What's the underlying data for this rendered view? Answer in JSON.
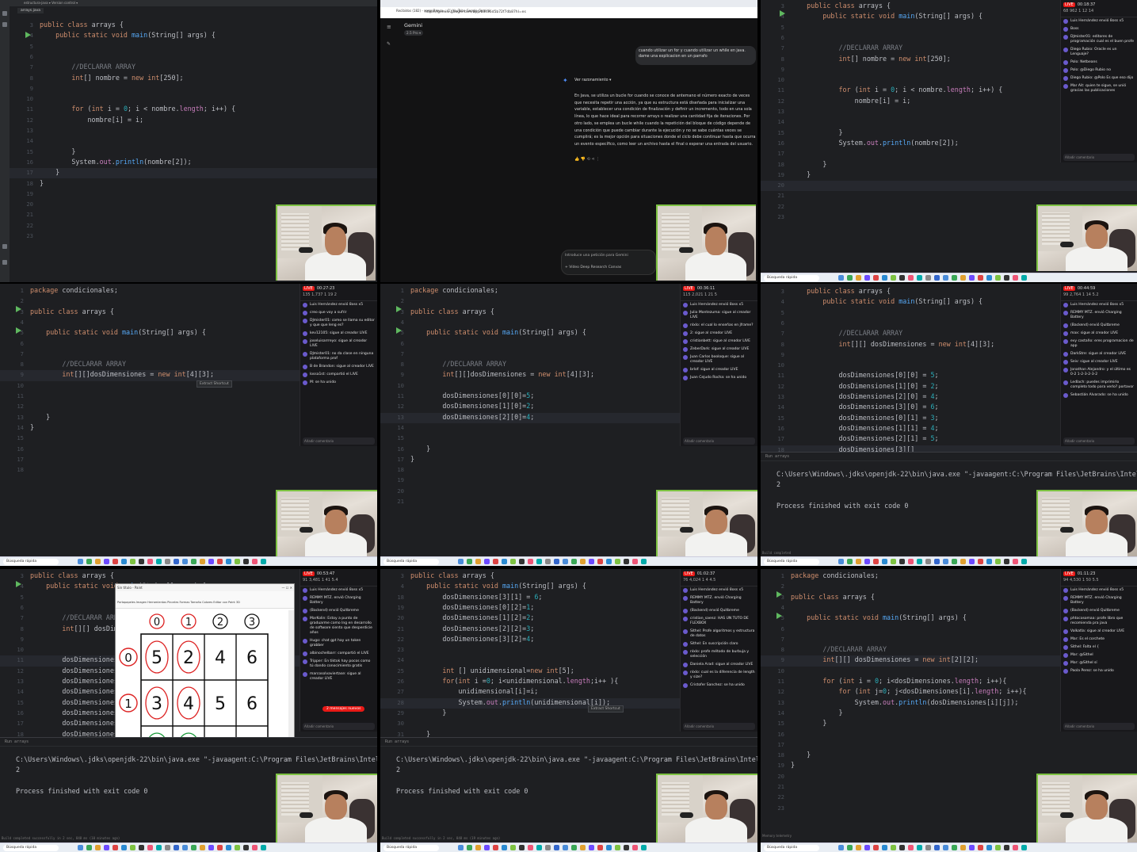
{
  "panel1": {
    "toolbar": "estructura-java ▾     Version control ▾",
    "file_tab": "arrays.java",
    "lines": [
      {
        "n": "3",
        "t": "public class arrays {"
      },
      {
        "n": "4",
        "t": "    public static void main(String[] args) {"
      },
      {
        "n": "5",
        "t": ""
      },
      {
        "n": "6",
        "t": ""
      },
      {
        "n": "7",
        "t": "        //DECLARAR ARRAY"
      },
      {
        "n": "8",
        "t": "        int[] nombre = new int[250];"
      },
      {
        "n": "9",
        "t": ""
      },
      {
        "n": "10",
        "t": ""
      },
      {
        "n": "11",
        "t": "        for (int i = 0; i < nombre.length; i++) {"
      },
      {
        "n": "12",
        "t": "            nombre[i] = i;"
      },
      {
        "n": "13",
        "t": ""
      },
      {
        "n": "14",
        "t": ""
      },
      {
        "n": "15",
        "t": "        }"
      },
      {
        "n": "16",
        "t": "        System.out.println(nombre[2]);"
      },
      {
        "n": "17",
        "t": "    }"
      },
      {
        "n": "18",
        "t": "}"
      },
      {
        "n": "19",
        "t": ""
      },
      {
        "n": "20",
        "t": ""
      },
      {
        "n": "21",
        "t": ""
      },
      {
        "n": "22",
        "t": ""
      },
      {
        "n": "23",
        "t": ""
      }
    ]
  },
  "panel2": {
    "tabs": "Recibidos (182) - sesanBanco...    (1) YouTube    Google Gemini",
    "url": "https://gemini.google.com/app/b3c36d5b72f7db87hl=es",
    "brand": "Gemini",
    "model": "2.5 Pro ▾",
    "question": "cuando utilizar un for y cuando utilizar un while en java. dame una explicacion en un parrafo",
    "reasoning": "Ver razonamiento",
    "answer": "En Java, se utiliza un bucle for cuando se conoce de antemano el número exacto de veces que necesita repetir una acción, ya que su estructura está diseñada para inicializar una variable, establecer una condición de finalización y definir un incremento, todo en una sola línea, lo que hace ideal para recorrer arrays o realizar una cantidad fija de iteraciones. Por otro lado, se emplea un bucle while cuando la repetición del bloque de código depende de una condición que puede cambiar durante la ejecución y no se sabe cuántas veces se cumplirá; es la mejor opción para situaciones donde el ciclo debe continuar hasta que ocurra un evento específico, como leer un archivo hasta el final o esperar una entrada del usuario.",
    "input_placeholder": "Introduce una petición para Gemini",
    "tools": "+    Vídeo    Deep Research    Canvas"
  },
  "panel3": {
    "lines": [
      {
        "n": "3",
        "t": "    public class arrays {"
      },
      {
        "n": "4",
        "t": "        public static void main(String[] args) {"
      },
      {
        "n": "5",
        "t": ""
      },
      {
        "n": "6",
        "t": ""
      },
      {
        "n": "7",
        "t": "            //DECLARAR ARRAY"
      },
      {
        "n": "8",
        "t": "            int[] nombre = new int[250];"
      },
      {
        "n": "9",
        "t": ""
      },
      {
        "n": "10",
        "t": ""
      },
      {
        "n": "11",
        "t": "            for (int i = 0; i < nombre.length; i++) {"
      },
      {
        "n": "12",
        "t": "                nombre[i] = i;"
      },
      {
        "n": "13",
        "t": ""
      },
      {
        "n": "14",
        "t": ""
      },
      {
        "n": "15",
        "t": "            }"
      },
      {
        "n": "16",
        "t": "            System.out.println(nombre[2]);"
      },
      {
        "n": "17",
        "t": ""
      },
      {
        "n": "18",
        "t": "        }"
      },
      {
        "n": "19",
        "t": "    }"
      },
      {
        "n": "20",
        "t": ""
      },
      {
        "n": "21",
        "t": ""
      },
      {
        "n": "22",
        "t": ""
      },
      {
        "n": "23",
        "t": ""
      }
    ],
    "live_time": "00:18:37",
    "stats": "68   962   1   12   14",
    "chat": [
      "Luis Hernández envió 8oss  x5",
      "Boss",
      "DJmister01: editores de programación cual es el buen profe",
      "Diego Rubio: Oracle es un Lenguaje?",
      "Polo: Netbeans",
      "Polo: @Diego Rubio no",
      "Diego Rubio: @Polo Es que eso dijo",
      "Mar Ait: quien te sigue, se unió gracias las publicaciones"
    ],
    "chat_input": "Añadir comentario"
  },
  "panel4": {
    "lines": [
      {
        "n": "1",
        "t": "package condicionales;"
      },
      {
        "n": "2",
        "t": ""
      },
      {
        "n": "3",
        "t": "public class arrays {"
      },
      {
        "n": "4",
        "t": ""
      },
      {
        "n": "5",
        "t": "    public static void main(String[] args) {"
      },
      {
        "n": "6",
        "t": ""
      },
      {
        "n": "7",
        "t": ""
      },
      {
        "n": "8",
        "t": "        //DECLARAR ARRAY"
      },
      {
        "n": "9",
        "t": "        int[][]dosDimensiones = new int[4][3];"
      },
      {
        "n": "10",
        "t": ""
      },
      {
        "n": "11",
        "t": ""
      },
      {
        "n": "12",
        "t": ""
      },
      {
        "n": "13",
        "t": "    }"
      },
      {
        "n": "14",
        "t": "}"
      },
      {
        "n": "15",
        "t": ""
      },
      {
        "n": "16",
        "t": ""
      },
      {
        "n": "17",
        "t": ""
      },
      {
        "n": "18",
        "t": ""
      }
    ],
    "live_time": "00:27:23",
    "stats": "135   1,737   1   19   2",
    "hint": "Extract   Shortcut",
    "chat": [
      "Luis Hernández envió 8oss  x5",
      "creo que voy a sufrir",
      "DJmister01: como se llama su editor y que que leng es?",
      "kev12105: sigue al creador LIVE",
      "joseluisarrreyo: sigue al creador LIVE",
      "DJmister01: no da clase en ninguna plataforma prof",
      "B de Brandon: sigue al creador LIVE",
      "lossa1st: compartió el LIVE",
      "M: se ha unido"
    ],
    "chat_input": "Añadir comentario"
  },
  "panel5": {
    "lines": [
      {
        "n": "1",
        "t": "package condicionales;"
      },
      {
        "n": "2",
        "t": ""
      },
      {
        "n": "3",
        "t": "public class arrays {"
      },
      {
        "n": "4",
        "t": ""
      },
      {
        "n": "5",
        "t": "    public static void main(String[] args) {"
      },
      {
        "n": "6",
        "t": ""
      },
      {
        "n": "7",
        "t": ""
      },
      {
        "n": "8",
        "t": "        //DECLARAR ARRAY"
      },
      {
        "n": "9",
        "t": "        int[][]dosDimensiones = new int[4][3];"
      },
      {
        "n": "10",
        "t": ""
      },
      {
        "n": "11",
        "t": "        dosDimensiones[0][0]=5;"
      },
      {
        "n": "12",
        "t": "        dosDimensiones[1][0]=2;"
      },
      {
        "n": "13",
        "t": "        dosDimensiones[2][0]=4;"
      },
      {
        "n": "14",
        "t": ""
      },
      {
        "n": "15",
        "t": ""
      },
      {
        "n": "16",
        "t": "    }"
      },
      {
        "n": "17",
        "t": "}"
      },
      {
        "n": "18",
        "t": ""
      },
      {
        "n": "19",
        "t": ""
      },
      {
        "n": "20",
        "t": ""
      },
      {
        "n": "21",
        "t": ""
      }
    ],
    "live_time": "00:36:11",
    "stats": "115   2,021   1   21   5",
    "chat": [
      "Luis Hernández envió 8oss  x5",
      "Julio Montezuma: sigue al creador LIVE",
      "nlxlo: el cual lo enseñas en jframe?",
      "2: sigue al creador LIVE",
      "cristianbett: sigue al creador LIVE",
      "ZeberDark: sigue al creador LIVE",
      "Juan Carlos booloque: sigue al creador LIVE",
      "brlof: sigue al creador LIVE",
      "Juan Cejudo Rocha: se ha unido"
    ],
    "chat_input": "Añadir comentario"
  },
  "panel6": {
    "lines": [
      {
        "n": "3",
        "t": "    public class arrays {"
      },
      {
        "n": "4",
        "t": "        public static void main(String[] args) {"
      },
      {
        "n": "5",
        "t": ""
      },
      {
        "n": "6",
        "t": ""
      },
      {
        "n": "7",
        "t": "            //DECLARAR ARRAY"
      },
      {
        "n": "8",
        "t": "            int[][] dosDimensiones = new int[4][3];"
      },
      {
        "n": "9",
        "t": ""
      },
      {
        "n": "10",
        "t": ""
      },
      {
        "n": "11",
        "t": "            dosDimensiones[0][0] = 5;"
      },
      {
        "n": "12",
        "t": "            dosDimensiones[1][0] = 2;"
      },
      {
        "n": "13",
        "t": "            dosDimensiones[2][0] = 4;"
      },
      {
        "n": "14",
        "t": "            dosDimensiones[3][0] = 6;"
      },
      {
        "n": "15",
        "t": "            dosDimensiones[0][1] = 3;"
      },
      {
        "n": "16",
        "t": "            dosDimensiones[1][1] = 4;"
      },
      {
        "n": "17",
        "t": "            dosDimensiones[2][1] = 5;"
      },
      {
        "n": "18",
        "t": "            dosDimensiones[3][]"
      },
      {
        "n": "19",
        "t": ""
      },
      {
        "n": "20",
        "t": "            System.out.println(dosDimensiones[1][0]);"
      }
    ],
    "run_tab": "Run     arrays",
    "term": [
      "C:\\Users\\Windows\\.jdks\\openjdk-22\\bin\\java.exe \"-javaagent:C:\\Program Files\\JetBrains\\IntelliJ",
      "2",
      "",
      "Process finished with exit code 0"
    ],
    "status": "Build completed",
    "live_time": "00:44:59",
    "stats": "99   2,764   1   14   5.2",
    "chat": [
      "Luis Hernández envió 8oss  x5",
      "REMMY MTZ. envió Charging Battery",
      "(Backend) envió Quitbreme",
      "max: sigue al creador LIVE",
      "evy castaño: eres programacion de app",
      "DarkStre: sigue al creador LIVE",
      "Seiv: sigue al creador LIVE",
      "Jonathan Alejandro: y el último es 0-2 1-2-3-2-3-2",
      "Ledlach: puedes imprimirlo completo todo para verlo? portavor",
      "Sebastián Alvarado: se ha unido"
    ],
    "chat_input": "Añadir comentario"
  },
  "panel7": {
    "lines": [
      {
        "n": "3",
        "t": "public class arrays {"
      },
      {
        "n": "4",
        "t": "    public static void main(String[] args) {"
      },
      {
        "n": "5",
        "t": ""
      },
      {
        "n": "6",
        "t": ""
      },
      {
        "n": "7",
        "t": "        //DECLARAR ARRAY"
      },
      {
        "n": "8",
        "t": "        int[][] dosDimensiones = new int[4][3];"
      },
      {
        "n": "9",
        "t": ""
      },
      {
        "n": "10",
        "t": ""
      },
      {
        "n": "11",
        "t": "        dosDimensiones[0][0] = 5;"
      },
      {
        "n": "12",
        "t": "        dosDimensiones[1][0] = 2;"
      },
      {
        "n": "13",
        "t": "        dosDimensiones[2][0] = 4;"
      },
      {
        "n": "14",
        "t": "        dosDimensiones[3][0] = 6;"
      },
      {
        "n": "15",
        "t": "        dosDimensiones[0][1] = 3;"
      },
      {
        "n": "16",
        "t": "        dosDimensiones[1][1] = 4;"
      },
      {
        "n": "17",
        "t": "        dosDimensiones[2][1] = 5;"
      },
      {
        "n": "18",
        "t": "        dosDimensiones[3][1] = 6;"
      },
      {
        "n": "19",
        "t": "        dosDimensiones[0][2] = 1;"
      }
    ],
    "paint_title": "Sin título - Paint",
    "paint_tools": "Portapapeles   Imagen   Herramientas   Pinceles   Formas   Tamaño   Colores   Editar con Paint 3D",
    "paint_status": "100%",
    "grid_cols": [
      "0",
      "1",
      "2",
      "3"
    ],
    "grid_rows": [
      "0",
      "1",
      "2"
    ],
    "grid_cells": [
      [
        "5",
        "2",
        "4",
        "6"
      ],
      [
        "3",
        "4",
        "5",
        "6"
      ],
      [
        "1",
        "2",
        "3",
        "4"
      ]
    ],
    "run_tab": "Run     arrays",
    "term": [
      "C:\\Users\\Windows\\.jdks\\openjdk-22\\bin\\java.exe \"-javaagent:C:\\Program Files\\JetBrains\\IntelliJ",
      "2",
      "",
      "Process finished with exit code 0"
    ],
    "status": "Build completed successfully in 2 sec, 848 ms (10 minutes ago)",
    "live_time": "00:53:47",
    "stats": "91   3,481   1   41   5.4",
    "new_messages": "2 mensajes nuevos",
    "chat": [
      "Luis Hernández envió 8oss  x5",
      "REMMY MTZ. envió Charging Battery",
      "(Backend) envió Quitbreme",
      "MarKolin: Estoy a punto de graduarme como Ing en desarrollo de software siento que desperdicie años",
      "Hugo: chat gpt hay un token grabber",
      "albinochelbarr: compartió el LIVE",
      "Tripper: En tiktok hay pocos como tú dando conocimiento gratis",
      "marcosolvaviertase: sigue al creador LIVE"
    ],
    "chat_input": "Añadir comentario"
  },
  "panel8": {
    "lines": [
      {
        "n": "3",
        "t": "public class arrays {"
      },
      {
        "n": "4",
        "t": "    public static void main(String[] args) {"
      },
      {
        "n": "18",
        "t": "        dosDimensiones[3][1] = 6;"
      },
      {
        "n": "19",
        "t": "        dosDimensiones[0][2]=1;"
      },
      {
        "n": "20",
        "t": "        dosDimensiones[1][2]=2;"
      },
      {
        "n": "21",
        "t": "        dosDimensiones[2][2]=3;"
      },
      {
        "n": "22",
        "t": "        dosDimensiones[3][2]=4;"
      },
      {
        "n": "23",
        "t": ""
      },
      {
        "n": "24",
        "t": ""
      },
      {
        "n": "25",
        "t": "        int [] unidimensional=new int[5];"
      },
      {
        "n": "26",
        "t": "        for(int i =0; i<unidimensional.length;i++ ){"
      },
      {
        "n": "27",
        "t": "            unidimensional[i]=i;"
      },
      {
        "n": "28",
        "t": "            System.out.println(unidimensional[i]);"
      },
      {
        "n": "29",
        "t": "        }"
      },
      {
        "n": "30",
        "t": ""
      },
      {
        "n": "31",
        "t": "    }"
      }
    ],
    "hint": "Extract   Shortcut",
    "run_tab": "Run     arrays",
    "term": [
      "C:\\Users\\Windows\\.jdks\\openjdk-22\\bin\\java.exe \"-javaagent:C:\\Program Files\\JetBrains\\IntelliJ",
      "2",
      "",
      "Process finished with exit code 0"
    ],
    "status": "Build completed successfully in 2 sec, 848 ms (19 minutes ago)",
    "live_time": "01:02:37",
    "stats": "76   4,024   1   4   4.5",
    "chat": [
      "Luis Hernández envió 8oss  x5",
      "REMMY MTZ. envió Charging Battery",
      "(Backend) envió Quitbreme",
      "cristian_saenz: HAS UN TUTO DE FLEXBOX",
      "Sithel: Profe algoritmos y estructura de datos",
      "Sithel: En suscripción claro",
      "nlxlo: profe método de burbuja y selección",
      "Daniela Arad: sigue al creador LIVE",
      "nlxlo: cual es la diferencia de length y size?",
      "Cristofer Sanchez: se ha unido"
    ],
    "chat_input": "Añadir comentario"
  },
  "panel9": {
    "lines": [
      {
        "n": "1",
        "t": "package condicionales;"
      },
      {
        "n": "2",
        "t": ""
      },
      {
        "n": "3",
        "t": "public class arrays {"
      },
      {
        "n": "4",
        "t": ""
      },
      {
        "n": "5",
        "t": "    public static void main(String[] args) {"
      },
      {
        "n": "6",
        "t": ""
      },
      {
        "n": "7",
        "t": ""
      },
      {
        "n": "8",
        "t": "        //DECLARAR ARRAY"
      },
      {
        "n": "9",
        "t": "        int[][] dosDimensiones = new int[2][2];"
      },
      {
        "n": "10",
        "t": ""
      },
      {
        "n": "11",
        "t": "        for (int i = 0; i<dosDimensiones.length; i++){"
      },
      {
        "n": "12",
        "t": "            for (int j=0; j<dosDimensiones[i].length; i++){"
      },
      {
        "n": "13",
        "t": "                System.out.println(dosDimensiones[i][j]);"
      },
      {
        "n": "14",
        "t": "            }"
      },
      {
        "n": "15",
        "t": "        }"
      },
      {
        "n": "16",
        "t": ""
      },
      {
        "n": "17",
        "t": ""
      },
      {
        "n": "18",
        "t": "    }"
      },
      {
        "n": "19",
        "t": "}"
      },
      {
        "n": "20",
        "t": ""
      },
      {
        "n": "21",
        "t": ""
      },
      {
        "n": "22",
        "t": ""
      },
      {
        "n": "23",
        "t": ""
      }
    ],
    "status": "Memory telemetry",
    "live_time": "01:11:23",
    "stats": "94   4,530   1   50   5.5",
    "chat": [
      "Luis Hernández envió 8oss  x5",
      "REMMY MTZ. envió Charging Battery",
      "(Backend) envió Quitbreme",
      "phtocosomaa: profe libro que recomienda pra java",
      "Valkatla: sigue al creador LIVE",
      "Mar: Es el corchete",
      "Sithel: Falta el {",
      "Mar: @Sithel",
      "Mar: @Sithel sí",
      "Paola Perez: se ha unido"
    ],
    "chat_input": "Añadir comentario"
  },
  "taskbar": {
    "search": "Búsqueda rápida"
  },
  "colors": {
    "editor_bg": "#1e1f22",
    "keyword": "#cf8e6d",
    "function": "#56a8f5",
    "number": "#2aacb8",
    "field": "#c77dbb",
    "comment": "#7a7e85",
    "live_red": "#e91916",
    "cam_border": "#7dc242"
  }
}
